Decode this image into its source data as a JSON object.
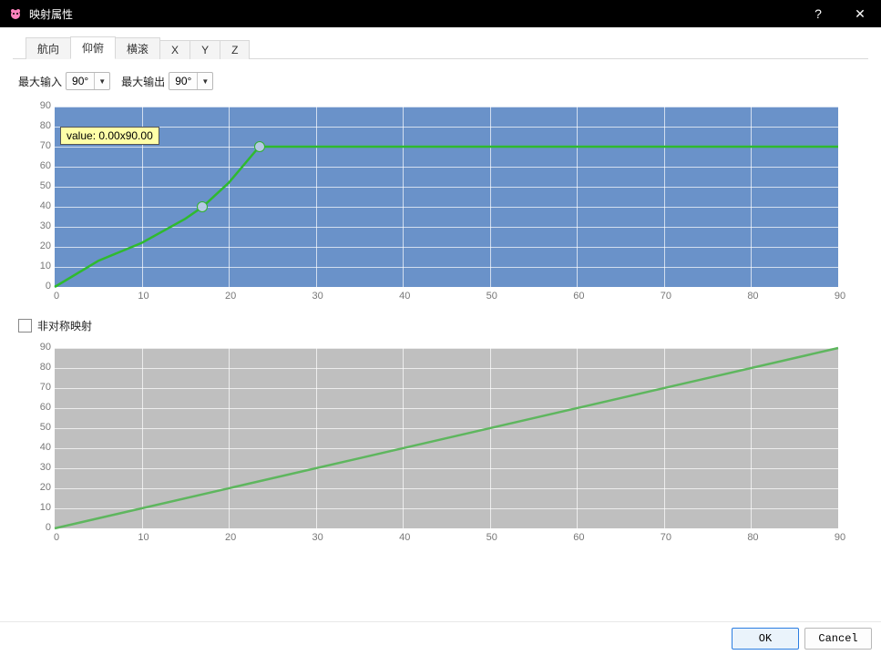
{
  "window": {
    "title": "映射属性",
    "help_symbol": "?",
    "close_symbol": "✕"
  },
  "tabs": [
    "航向",
    "仰俯",
    "横滚",
    "X",
    "Y",
    "Z"
  ],
  "active_tab_index": 1,
  "inputs": {
    "max_input_label": "最大输入",
    "max_input_value": "90°",
    "max_output_label": "最大输出",
    "max_output_value": "90°"
  },
  "tooltip_text": "value: 0.00x90.00",
  "asym_label": "非对称映射",
  "asym_checked": false,
  "buttons": {
    "ok": "OK",
    "cancel": "Cancel"
  },
  "chart_data": [
    {
      "id": "top",
      "type": "line",
      "background": "#6a92c9",
      "line_color": "#2fba2f",
      "xlim": [
        0,
        90
      ],
      "ylim": [
        0,
        90
      ],
      "xticks": [
        0,
        10,
        20,
        30,
        40,
        50,
        60,
        70,
        80,
        90
      ],
      "yticks": [
        0,
        10,
        20,
        30,
        40,
        50,
        60,
        70,
        80,
        90
      ],
      "series": [
        {
          "name": "curve",
          "x": [
            0,
            5,
            10,
            15,
            17,
            20,
            23.5,
            30,
            40,
            50,
            60,
            70,
            80,
            90
          ],
          "y": [
            0,
            13,
            22,
            34,
            40,
            52,
            70,
            70,
            70,
            70,
            70,
            70,
            70,
            70
          ]
        }
      ],
      "control_points": [
        {
          "x": 17,
          "y": 40
        },
        {
          "x": 23.5,
          "y": 70
        }
      ],
      "tooltip": "value: 0.00x90.00"
    },
    {
      "id": "bottom",
      "type": "line",
      "background": "#bfbfbf",
      "line_color": "#5eb65e",
      "xlim": [
        0,
        90
      ],
      "ylim": [
        0,
        90
      ],
      "xticks": [
        0,
        10,
        20,
        30,
        40,
        50,
        60,
        70,
        80,
        90
      ],
      "yticks": [
        0,
        10,
        20,
        30,
        40,
        50,
        60,
        70,
        80,
        90
      ],
      "series": [
        {
          "name": "linear",
          "x": [
            0,
            90
          ],
          "y": [
            0,
            90
          ]
        }
      ],
      "control_points": []
    }
  ]
}
